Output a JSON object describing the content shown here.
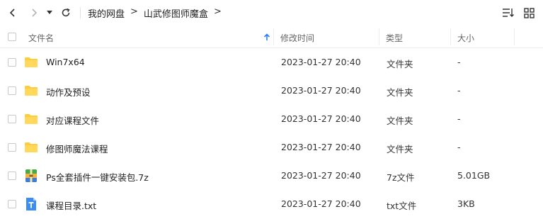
{
  "breadcrumb": {
    "root": "我的网盘",
    "sep1": ">",
    "current": "山武修图师魔盒",
    "sep2": ">"
  },
  "columns": {
    "name": "文件名",
    "modified": "修改时间",
    "type": "类型",
    "size": "大小"
  },
  "files": [
    {
      "name": "Win7x64",
      "modified": "2023-01-27  20:40",
      "type": "文件夹",
      "size": "-",
      "icon": "folder-icon"
    },
    {
      "name": "动作及预设",
      "modified": "2023-01-27  20:40",
      "type": "文件夹",
      "size": "-",
      "icon": "folder-icon"
    },
    {
      "name": "对应课程文件",
      "modified": "2023-01-27  20:40",
      "type": "文件夹",
      "size": "-",
      "icon": "folder-icon"
    },
    {
      "name": "修图师魔法课程",
      "modified": "2023-01-27  20:40",
      "type": "文件夹",
      "size": "-",
      "icon": "folder-icon"
    },
    {
      "name": "Ps全套插件一键安装包.7z",
      "modified": "2023-01-27  20:40",
      "type": "7z文件",
      "size": "5.01GB",
      "icon": "archive-icon"
    },
    {
      "name": "课程目录.txt",
      "modified": "2023-01-27  20:40",
      "type": "txt文件",
      "size": "3KB",
      "icon": "txt-file-icon"
    }
  ],
  "colors": {
    "folder": "#ffcd3a",
    "accent": "#2b7cff",
    "txt": "#3c8cf6"
  }
}
